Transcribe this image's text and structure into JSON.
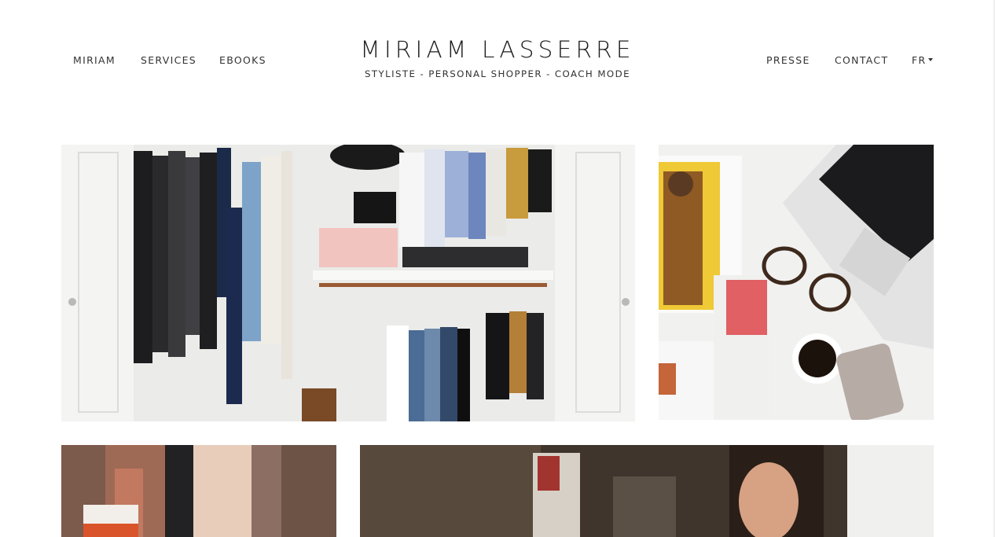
{
  "nav": {
    "left": [
      {
        "label": "MIRIAM"
      },
      {
        "label": "SERVICES"
      },
      {
        "label": "EBOOKS"
      }
    ],
    "right": [
      {
        "label": "PRESSE"
      },
      {
        "label": "CONTACT"
      }
    ],
    "language": {
      "label": "FR",
      "icon": "caret-down-icon"
    }
  },
  "brand": {
    "title": "MIRIAM LASSERRE",
    "tagline": "STYLISTE - PERSONAL SHOPPER - COACH MODE"
  },
  "colors": {
    "background": "#ffffff",
    "text": "#333333",
    "title": "#1e1e1e"
  },
  "gallery": [
    {
      "subject": "open wardrobe with hanging clothes and pink box"
    },
    {
      "subject": "desk flat lay with laptop, glasses, coffee, phone and magazines"
    },
    {
      "subject": "two women in coats holding shopping bags"
    },
    {
      "subject": "smiling woman portrait in interior"
    }
  ]
}
